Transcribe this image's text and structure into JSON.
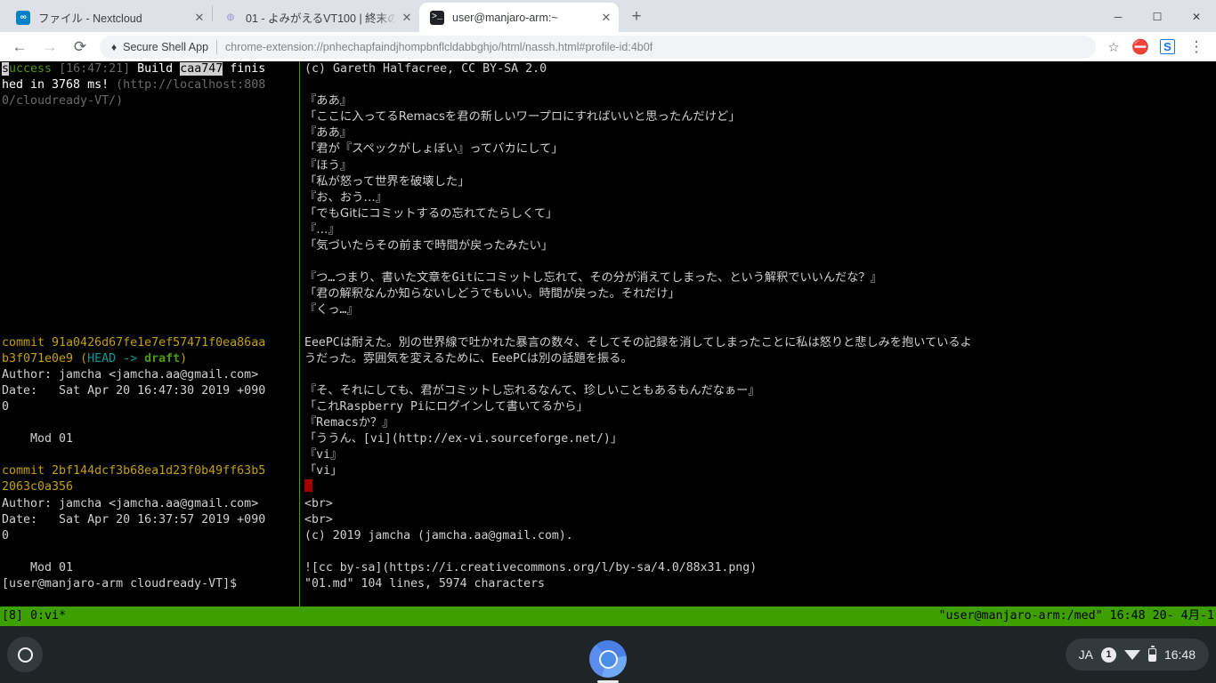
{
  "browser": {
    "tabs": [
      {
        "title": "ファイル - Nextcloud",
        "favicon": "nextcloud-icon",
        "favicon_text": "∞",
        "active": false,
        "close_label": "✕"
      },
      {
        "title": "01 - よみがえるVT100 | 終末の",
        "favicon": "scrapbox-icon",
        "favicon_text": "◍",
        "active": false,
        "close_label": "✕"
      },
      {
        "title": "user@manjaro-arm:~",
        "favicon": "terminal-icon",
        "favicon_text": ">_",
        "active": true,
        "close_label": "✕"
      }
    ],
    "new_tab_label": "+",
    "window_controls": {
      "minimize": "─",
      "maximize": "☐",
      "close": "✕"
    },
    "nav": {
      "back": "←",
      "forward": "→",
      "reload": "⟳"
    },
    "omnibox": {
      "extension_icon": "puzzle-icon",
      "extension_label": "Secure Shell App",
      "url": "chrome-extension://pnhechapfaindjhompbnflcldabbghjo/html/nassh.html#profile-id:4b0f"
    },
    "toolbar_icons": {
      "bookmark": "☆",
      "blocker": "🚫",
      "extension_s": "S",
      "menu": "⋮"
    }
  },
  "terminal": {
    "left_pane": {
      "lines": [
        {
          "segments": [
            {
              "text": "s",
              "cls": "inv"
            },
            {
              "text": "uccess",
              "cls": "c-green"
            },
            {
              "text": " ",
              "cls": ""
            },
            {
              "text": "[16:47:21]",
              "cls": "c-gray"
            },
            {
              "text": " ",
              "cls": ""
            },
            {
              "text": "Build ",
              "cls": "c-white"
            },
            {
              "text": "caa747",
              "cls": "inv"
            },
            {
              "text": " finis",
              "cls": "c-white"
            }
          ]
        },
        {
          "segments": [
            {
              "text": "hed in 3768 ms! ",
              "cls": "c-white"
            },
            {
              "text": "(http://localhost:808",
              "cls": "c-gray"
            }
          ]
        },
        {
          "segments": [
            {
              "text": "0/cloudready-VT/)",
              "cls": "c-gray"
            }
          ]
        },
        {
          "segments": []
        },
        {
          "segments": []
        },
        {
          "segments": []
        },
        {
          "segments": []
        },
        {
          "segments": []
        },
        {
          "segments": []
        },
        {
          "segments": []
        },
        {
          "segments": []
        },
        {
          "segments": []
        },
        {
          "segments": []
        },
        {
          "segments": []
        },
        {
          "segments": []
        },
        {
          "segments": []
        },
        {
          "segments": []
        },
        {
          "segments": [
            {
              "text": "commit 91a0426d67fe1e7ef57471f0ea86aa",
              "cls": "c-yellow"
            }
          ]
        },
        {
          "segments": [
            {
              "text": "b3f071e0e9 ",
              "cls": "c-yellow"
            },
            {
              "text": "(",
              "cls": "c-yellow"
            },
            {
              "text": "HEAD -> ",
              "cls": "c-cyan"
            },
            {
              "text": "draft",
              "cls": "c-brgreen"
            },
            {
              "text": ")",
              "cls": "c-yellow"
            }
          ]
        },
        {
          "segments": [
            {
              "text": "Author: jamcha <jamcha.aa@gmail.com>",
              "cls": ""
            }
          ]
        },
        {
          "segments": [
            {
              "text": "Date:   Sat Apr 20 16:47:30 2019 +090",
              "cls": ""
            }
          ]
        },
        {
          "segments": [
            {
              "text": "0",
              "cls": ""
            }
          ]
        },
        {
          "segments": []
        },
        {
          "segments": [
            {
              "text": "    Mod 01",
              "cls": ""
            }
          ]
        },
        {
          "segments": []
        },
        {
          "segments": [
            {
              "text": "commit 2bf144dcf3b68ea1d23f0b49ff63b5",
              "cls": "c-yellow"
            }
          ]
        },
        {
          "segments": [
            {
              "text": "2063c0a356",
              "cls": "c-yellow"
            }
          ]
        },
        {
          "segments": [
            {
              "text": "Author: jamcha <jamcha.aa@gmail.com>",
              "cls": ""
            }
          ]
        },
        {
          "segments": [
            {
              "text": "Date:   Sat Apr 20 16:37:57 2019 +090",
              "cls": ""
            }
          ]
        },
        {
          "segments": [
            {
              "text": "0",
              "cls": ""
            }
          ]
        },
        {
          "segments": []
        },
        {
          "segments": [
            {
              "text": "    Mod 01",
              "cls": ""
            }
          ]
        },
        {
          "segments": [
            {
              "text": "[user@manjaro-arm cloudready-VT]$",
              "cls": ""
            }
          ]
        }
      ]
    },
    "right_pane": {
      "lines": [
        {
          "text": "(c) Gareth Halfacree, CC BY-SA 2.0",
          "style": "mono"
        },
        {
          "text": "",
          "style": "mono"
        },
        {
          "text": "『ああ』",
          "style": "jp"
        },
        {
          "text": "「ここに入ってるRemacsを君の新しいワープロにすればいいと思ったんだけど」",
          "style": "jp"
        },
        {
          "text": "『ああ』",
          "style": "jp"
        },
        {
          "text": "「君が『スペックがしょぼい』ってバカにして」",
          "style": "jp"
        },
        {
          "text": "『ほう』",
          "style": "jp"
        },
        {
          "text": "「私が怒って世界を破壊した」",
          "style": "jp"
        },
        {
          "text": "『お、おう…』",
          "style": "jp"
        },
        {
          "text": "「でもGitにコミットするの忘れてたらしくて」",
          "style": "jp"
        },
        {
          "text": "『…』",
          "style": "jp"
        },
        {
          "text": "「気づいたらその前まで時間が戻ったみたい」",
          "style": "jp"
        },
        {
          "text": "",
          "style": "mono"
        },
        {
          "text": "『つ…つまり、書いた文章をGitにコミットし忘れて、その分が消えてしまった、という解釈でいいんだな？』",
          "style": "narrow"
        },
        {
          "text": "「君の解釈なんか知らないしどうでもいい。時間が戻った。それだけ」",
          "style": "narrow"
        },
        {
          "text": "『くっ…』",
          "style": "narrow"
        },
        {
          "text": "",
          "style": "mono"
        },
        {
          "text": "EeePCは耐えた。別の世界線で吐かれた暴言の数々、そしてその記録を消してしまったことに私は怒りと悲しみを抱いているよ",
          "style": "narrow"
        },
        {
          "text": "うだった。雰囲気を変えるために、EeePCは別の話題を振る。",
          "style": "narrow"
        },
        {
          "text": "",
          "style": "mono"
        },
        {
          "text": "『そ、それにしても、君がコミットし忘れるなんて、珍しいこともあるもんだなぁー』",
          "style": "narrow"
        },
        {
          "text": "「これRaspberry Piにログインして書いてるから」",
          "style": "narrow"
        },
        {
          "text": "『Remacsか？』",
          "style": "narrow"
        },
        {
          "text": "「ううん、[vi](http://ex-vi.sourceforge.net/)」",
          "style": "narrow"
        },
        {
          "text": "『vi』",
          "style": "narrow"
        },
        {
          "text": "「vi」",
          "style": "narrow"
        },
        {
          "text": "",
          "style": "cursor"
        },
        {
          "text": "<br>",
          "style": "narrow"
        },
        {
          "text": "<br>",
          "style": "narrow"
        },
        {
          "text": "(c) 2019 jamcha (jamcha.aa@gmail.com).",
          "style": "narrow"
        },
        {
          "text": "",
          "style": "mono"
        },
        {
          "text": "![cc by-sa](https://i.creativecommons.org/l/by-sa/4.0/88x31.png)",
          "style": "narrow"
        },
        {
          "text": "\"01.md\" 104 lines, 5974 characters",
          "style": "narrow"
        }
      ]
    },
    "status_bar": {
      "left": "[8] 0:vi*",
      "right": "\"user@manjaro-arm:/med\" 16:48 20- 4月-1",
      "background": "#3ea000"
    }
  },
  "shelf": {
    "launcher_name": "launcher-button",
    "app_name": "chromium-app",
    "tray": {
      "input_method": "JA",
      "notification_count": "1",
      "clock": "16:48"
    }
  }
}
